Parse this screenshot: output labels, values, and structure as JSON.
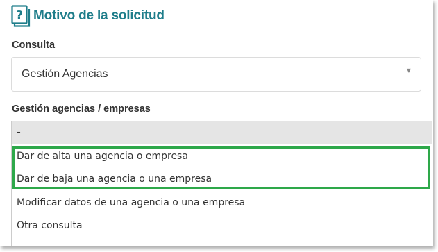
{
  "section": {
    "title": "Motivo de la solicitud",
    "icon": "help-question-icon"
  },
  "consulta": {
    "label": "Consulta",
    "selected_value": "Gestión Agencias"
  },
  "gestion": {
    "label": "Gestión agencias / empresas",
    "options": [
      {
        "label": "-",
        "selected": true
      },
      {
        "label": "Dar de alta una agencia o empresa",
        "highlighted": true
      },
      {
        "label": "Dar de baja una agencia o una empresa",
        "highlighted": true
      },
      {
        "label": "Modificar datos de una agencia o una empresa"
      },
      {
        "label": "Otra consulta"
      }
    ]
  },
  "colors": {
    "title": "#1e7d8a",
    "highlight": "#2ea84a",
    "selected_option_bg": "#e5e5e5"
  }
}
